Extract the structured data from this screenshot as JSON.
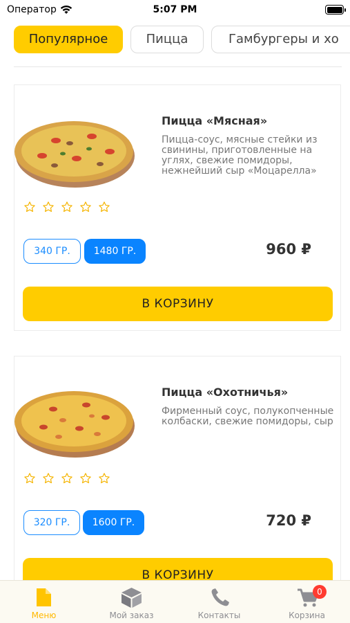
{
  "status_bar": {
    "carrier": "Оператор",
    "time": "5:07 PM"
  },
  "categories": [
    {
      "label": "Популярное",
      "active": true
    },
    {
      "label": "Пицца",
      "active": false
    },
    {
      "label": "Гамбургеры и хо",
      "active": false
    }
  ],
  "products": [
    {
      "title": "Пицца «Мясная»",
      "description": "Пицца-соус, мясные стейки из свинины, приготовленные на углях, свежие помидоры, нежнейший сыр «Моцарелла»",
      "rating": 0,
      "sizes": [
        {
          "label": "340 ГР.",
          "selected": false
        },
        {
          "label": "1480 ГР.",
          "selected": true
        }
      ],
      "price": "960 ₽",
      "cart_label": "В КОРЗИНУ"
    },
    {
      "title": "Пицца «Охотничья»",
      "description": "Фирменный соус, полукопченные колбаски, свежие помидоры, сыр",
      "rating": 0,
      "sizes": [
        {
          "label": "320 ГР.",
          "selected": false
        },
        {
          "label": "1600 ГР.",
          "selected": true
        }
      ],
      "price": "720 ₽",
      "cart_label": "В КОРЗИНУ"
    }
  ],
  "tabbar": {
    "items": [
      {
        "label": "Меню",
        "icon": "document-icon",
        "active": true
      },
      {
        "label": "Мой заказ",
        "icon": "box-icon",
        "active": false
      },
      {
        "label": "Контакты",
        "icon": "phone-icon",
        "active": false
      },
      {
        "label": "Корзина",
        "icon": "cart-icon",
        "active": false,
        "badge": "0"
      }
    ]
  },
  "colors": {
    "accent_yellow": "#ffcc00",
    "accent_blue": "#0a84ff",
    "badge_red": "#ff3b30"
  }
}
